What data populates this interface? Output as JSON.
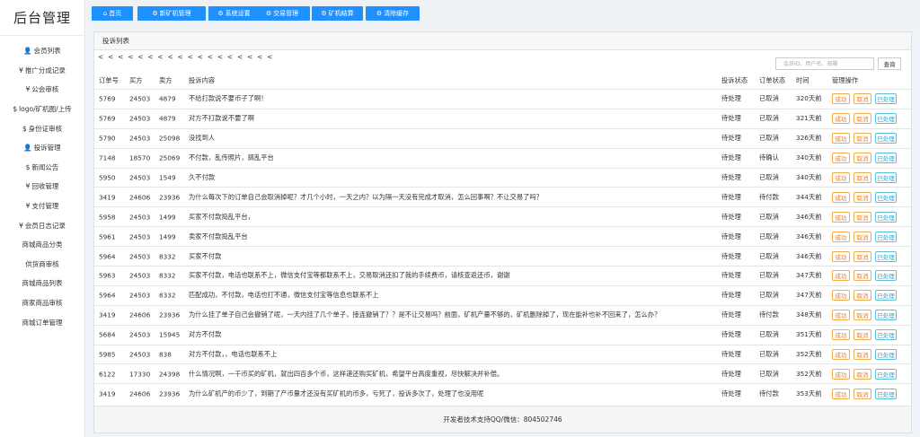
{
  "brand": "后台管理",
  "sidebar": {
    "items": [
      {
        "icon": "👤",
        "icon_name": "user-icon",
        "label": "会员列表"
      },
      {
        "icon": "¥",
        "icon_name": "yen-icon",
        "label": "推广分成记录"
      },
      {
        "icon": "¥",
        "icon_name": "yen-icon",
        "label": "公会审核"
      },
      {
        "icon": "$",
        "icon_name": "dollar-icon",
        "label": "logo/矿机图/上传"
      },
      {
        "icon": "$",
        "icon_name": "dollar-icon",
        "label": "身份证审核"
      },
      {
        "icon": "👤",
        "icon_name": "user-icon",
        "label": "投诉管理"
      },
      {
        "icon": "$",
        "icon_name": "dollar-icon",
        "label": "新闻公告"
      },
      {
        "icon": "¥",
        "icon_name": "yen-icon",
        "label": "回收管理"
      },
      {
        "icon": "¥",
        "icon_name": "yen-icon",
        "label": "支付管理"
      },
      {
        "icon": "¥",
        "icon_name": "yen-icon",
        "label": "会员日志记录"
      },
      {
        "icon": "",
        "icon_name": "",
        "label": "商城商品分类"
      },
      {
        "icon": "",
        "icon_name": "",
        "label": "供货商审核"
      },
      {
        "icon": "",
        "icon_name": "",
        "label": "商城商品列表"
      },
      {
        "icon": "",
        "icon_name": "",
        "label": "商家商品审核"
      },
      {
        "icon": "",
        "icon_name": "",
        "label": "商城订单管理"
      }
    ]
  },
  "tabs": [
    {
      "icon": "⌂",
      "icon_name": "home-icon",
      "label": "首页"
    },
    {
      "icon": "⚙",
      "icon_name": "gear-icon",
      "label": "新矿机管理"
    },
    {
      "icon": "⚙",
      "icon_name": "gear-icon",
      "label": "系统设置"
    },
    {
      "icon": "⚙",
      "icon_name": "gear-icon",
      "label": "交易管理"
    },
    {
      "icon": "⚙",
      "icon_name": "gear-icon",
      "label": "矿机结算"
    },
    {
      "icon": "⚙",
      "icon_name": "gear-icon",
      "label": "清除缓存"
    }
  ],
  "panel": {
    "title": "投诉列表",
    "pager": "< < < < < < < < < < < < < < < < < <",
    "search": {
      "placeholder": "会员ID、用户名、邮箱",
      "button": "查询"
    },
    "columns": {
      "id": "订单号",
      "buyer": "买方",
      "seller": "卖方",
      "content": "投诉内容",
      "complaint_status": "投诉状态",
      "order_status": "订单状态",
      "time": "时间",
      "ops": "管理操作"
    },
    "actions": {
      "ok": "成功",
      "cancel": "取消",
      "done": "已处理"
    },
    "rows": [
      {
        "id": "5769",
        "buyer": "24503",
        "seller": "4879",
        "content": "不给打款说不要币子了啊！",
        "cs": "待处理",
        "os": "已取消",
        "time": "320天前"
      },
      {
        "id": "5769",
        "buyer": "24503",
        "seller": "4879",
        "content": "对方不打款说不要了啊",
        "cs": "待处理",
        "os": "已取消",
        "time": "321天前"
      },
      {
        "id": "5790",
        "buyer": "24503",
        "seller": "25098",
        "content": "没找到人",
        "cs": "待处理",
        "os": "已取消",
        "time": "326天前"
      },
      {
        "id": "7148",
        "buyer": "18570",
        "seller": "25069",
        "content": "不付款，乱传照片，搞乱平台",
        "cs": "待处理",
        "os": "待确认",
        "time": "340天前"
      },
      {
        "id": "5950",
        "buyer": "24503",
        "seller": "1549",
        "content": "久不付款",
        "cs": "待处理",
        "os": "已取消",
        "time": "340天前"
      },
      {
        "id": "3419",
        "buyer": "24606",
        "seller": "23936",
        "content": "为什么每次下的订单自己会取消掉呢？才几个小时，一天之内？以为隔一天没有完成才取消，怎么回事啊？不让交易了吗？",
        "cs": "待处理",
        "os": "待付款",
        "time": "344天前"
      },
      {
        "id": "5958",
        "buyer": "24503",
        "seller": "1499",
        "content": "买家不付款捣乱平台，",
        "cs": "待处理",
        "os": "已取消",
        "time": "346天前"
      },
      {
        "id": "5961",
        "buyer": "24503",
        "seller": "1499",
        "content": "卖家不付款捣乱平台",
        "cs": "待处理",
        "os": "已取消",
        "time": "346天前"
      },
      {
        "id": "5964",
        "buyer": "24503",
        "seller": "8332",
        "content": "买家不付款",
        "cs": "待处理",
        "os": "已取消",
        "time": "346天前"
      },
      {
        "id": "5963",
        "buyer": "24503",
        "seller": "8332",
        "content": "买家不付款，电话也联系不上，微信支付宝等都联系不上，交易取消还扣了我的手续费币，请核查返还币，谢谢",
        "cs": "待处理",
        "os": "已取消",
        "time": "347天前"
      },
      {
        "id": "5964",
        "buyer": "24503",
        "seller": "8332",
        "content": "匹配成功，不付款，电话也打不通，微信支付宝等信息也联系不上",
        "cs": "待处理",
        "os": "已取消",
        "time": "347天前"
      },
      {
        "id": "3419",
        "buyer": "24606",
        "seller": "23936",
        "content": "为什么挂了单子自己会撤销了呢，一天内挂了几个单子，接连撤销了？？是不让交易吗？前面，矿机产量不够的，矿机删除掉了，现在能补也补不回来了，怎么办？",
        "cs": "待处理",
        "os": "待付款",
        "time": "348天前"
      },
      {
        "id": "5684",
        "buyer": "24503",
        "seller": "15945",
        "content": "对方不付款",
        "cs": "待处理",
        "os": "已取消",
        "time": "351天前"
      },
      {
        "id": "5985",
        "buyer": "24503",
        "seller": "838",
        "content": "对方不付款，，电话也联系不上",
        "cs": "待处理",
        "os": "已取消",
        "time": "352天前"
      },
      {
        "id": "6122",
        "buyer": "17330",
        "seller": "24398",
        "content": "什么情况啊，一千币买的矿机，就出四百多个币，这样递还购买矿机，希望平台高度重视，尽快解决并补偿。",
        "cs": "待处理",
        "os": "已取消",
        "time": "352天前"
      },
      {
        "id": "3419",
        "buyer": "24606",
        "seller": "23936",
        "content": "为什么矿机产的币少了，到期了产币量才还没有买矿机的币多，亏死了，投诉多次了，处理了也没用呢",
        "cs": "待处理",
        "os": "待付款",
        "time": "353天前"
      }
    ],
    "footer": "开发者技术支持QQ/微信：804502746"
  },
  "colors": {
    "tab_blue": "#1e90ff",
    "action_orange": "#e67e22",
    "action_blue": "#31a6d1"
  }
}
